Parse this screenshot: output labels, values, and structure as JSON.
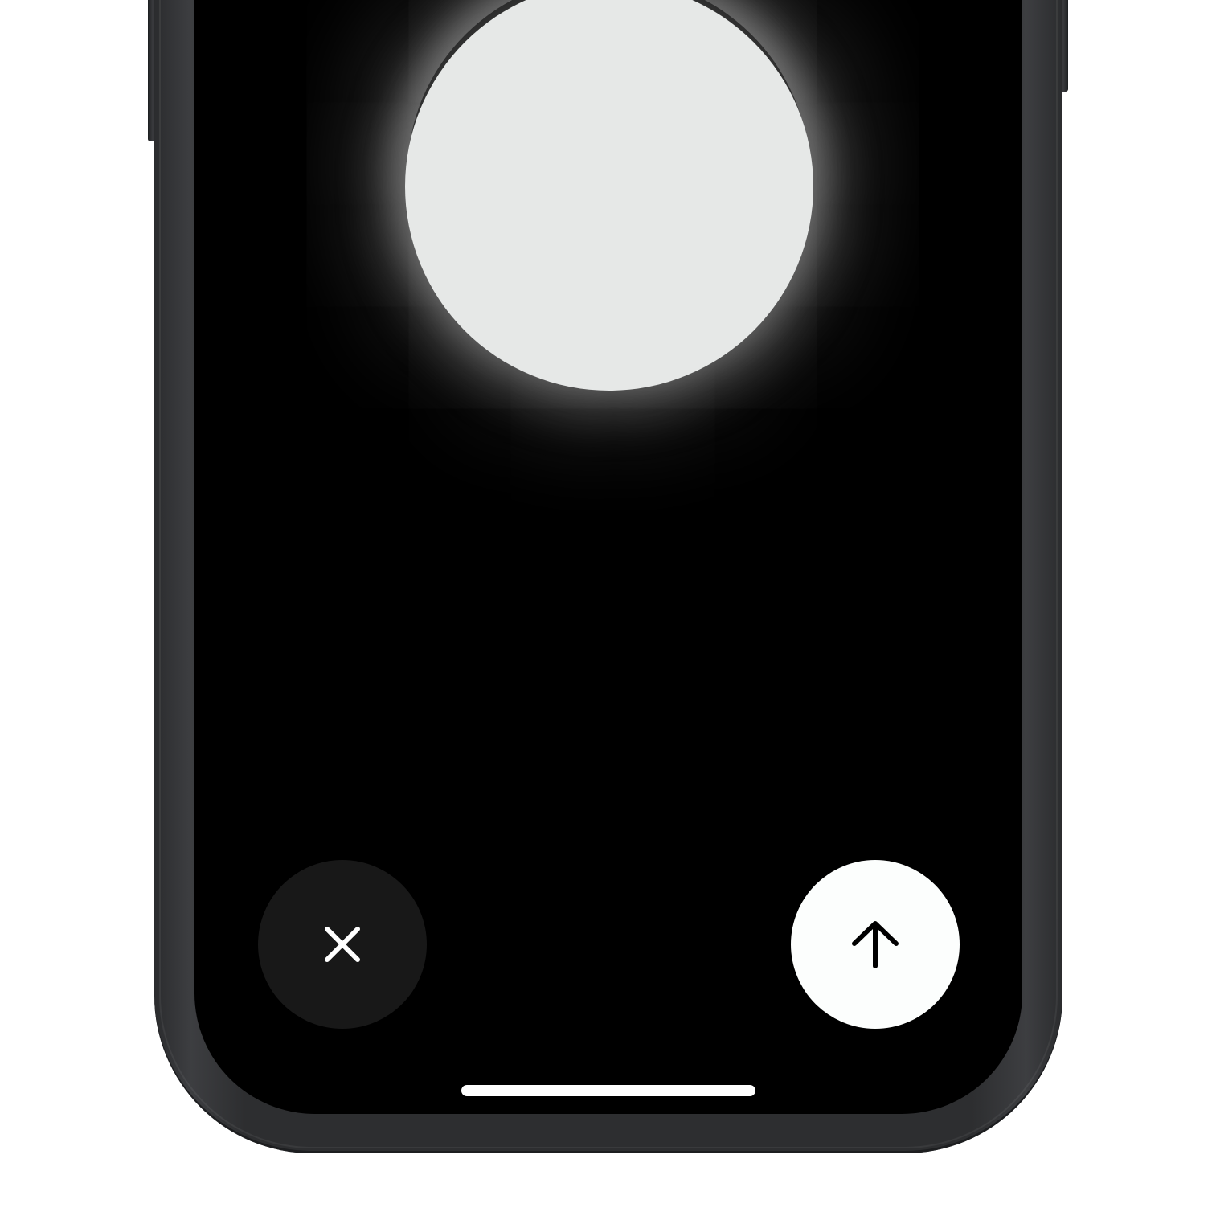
{
  "device": {
    "type": "phone",
    "frame_color": "#2d2e30",
    "screen_color": "#000000"
  },
  "voice_orb": {
    "color": "#e6e8e7",
    "state": "listening"
  },
  "controls": {
    "cancel": {
      "icon": "close-icon",
      "background": "#181818",
      "icon_color": "#ffffff"
    },
    "send": {
      "icon": "arrow-up-icon",
      "background": "#fcfefd",
      "icon_color": "#000000"
    }
  },
  "home_indicator": {
    "color": "#ffffff"
  }
}
